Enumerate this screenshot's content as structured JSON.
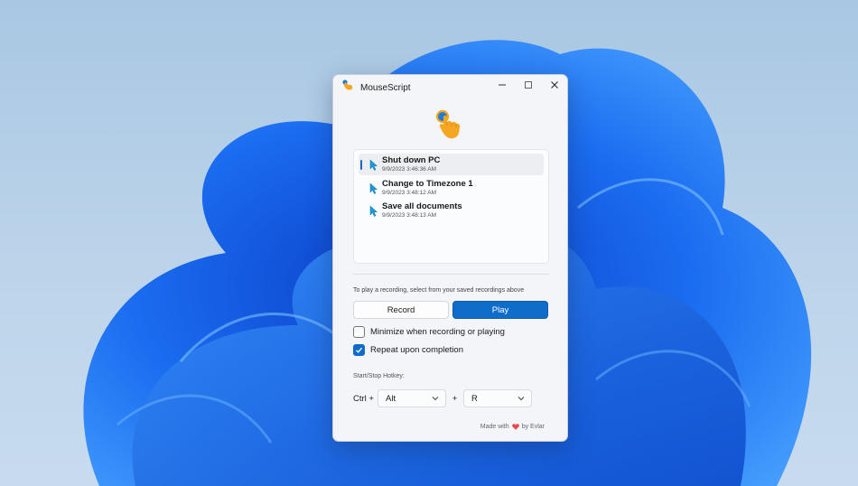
{
  "window": {
    "title": "MouseScript",
    "caption": {
      "minimize": "minimize",
      "maximize": "maximize",
      "close": "close"
    }
  },
  "recordings": [
    {
      "name": "Shut down PC",
      "time": "9/9/2023 3:46:36 AM",
      "selected": true
    },
    {
      "name": "Change to Timezone 1",
      "time": "9/9/2023 3:48:12 AM",
      "selected": false
    },
    {
      "name": "Save all documents",
      "time": "9/9/2023 3:48:13 AM",
      "selected": false
    }
  ],
  "hint": "To play a recording, select from your saved recordings above",
  "buttons": {
    "record": "Record",
    "play": "Play"
  },
  "options": {
    "minimize_label": "Minimize when recording or playing",
    "minimize_checked": false,
    "repeat_label": "Repeat upon completion",
    "repeat_checked": true
  },
  "hotkey": {
    "label": "Start/Stop Hotkey:",
    "ctrl": "Ctrl +",
    "modifier": "Alt",
    "plus": "+",
    "key": "R"
  },
  "footer": {
    "prefix": "Made with",
    "suffix": "by Evlar"
  },
  "colors": {
    "accent": "#0f6cc9",
    "heart": "#e8474c",
    "hand": "#f5a623",
    "cursor": "#1e9ad6"
  },
  "icons": {
    "app": "pointing-hand-icon",
    "item": "mouse-cursor-icon",
    "dropdown": "chevron-down-icon",
    "heart": "heart-icon"
  }
}
